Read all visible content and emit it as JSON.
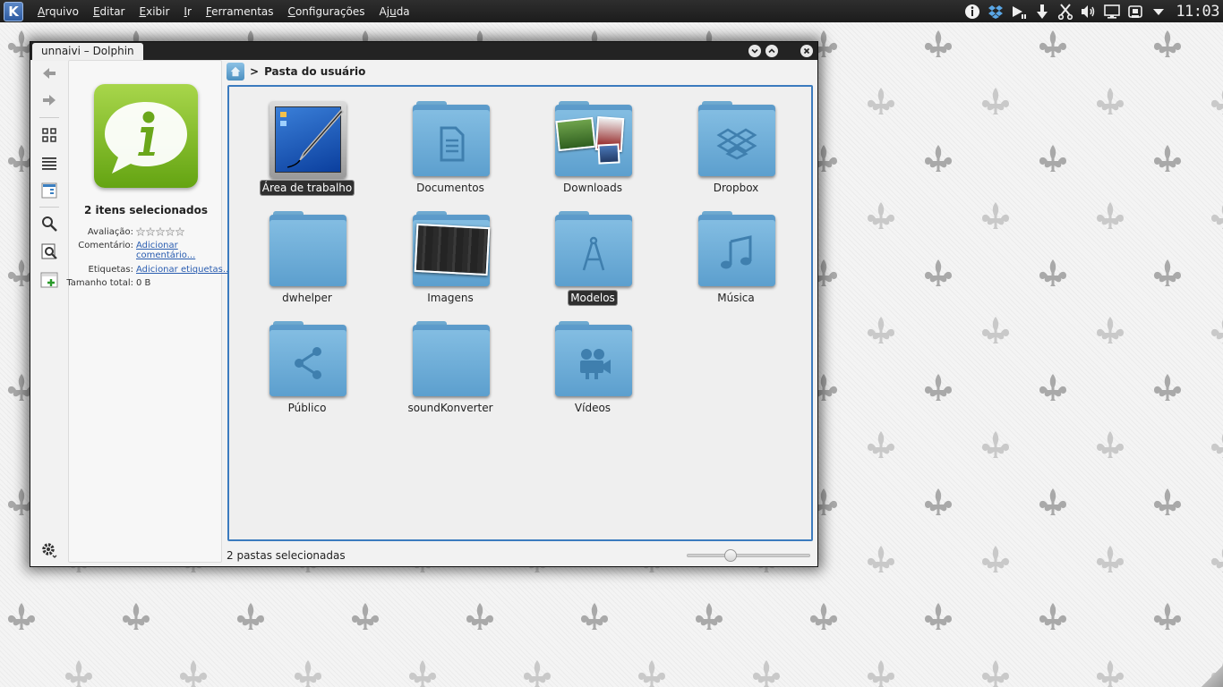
{
  "panel": {
    "kde_label": "K",
    "menus": [
      {
        "pre": "",
        "acc": "A",
        "post": "rquivo"
      },
      {
        "pre": "",
        "acc": "E",
        "post": "ditar"
      },
      {
        "pre": "",
        "acc": "E",
        "post": "xibir"
      },
      {
        "pre": "",
        "acc": "I",
        "post": "r"
      },
      {
        "pre": "",
        "acc": "F",
        "post": "erramentas"
      },
      {
        "pre": "",
        "acc": "C",
        "post": "onfigurações"
      },
      {
        "pre": "Aj",
        "acc": "u",
        "post": "da"
      }
    ],
    "tray_icons": [
      "info-icon",
      "dropbox-icon",
      "media-player-icon",
      "download-icon",
      "scissors-icon",
      "volume-icon",
      "display-icon",
      "network-icon",
      "expand-arrow-icon"
    ],
    "clock": "11:03"
  },
  "window": {
    "title": "unnaivi – Dolphin"
  },
  "info_panel": {
    "title": "2 itens selecionados",
    "rating_label": "Avaliação:",
    "rating_value": 0,
    "rating_max": 5,
    "comment_label": "Comentário:",
    "comment_link": "Adicionar comentário...",
    "tags_label": "Etiquetas:",
    "tags_link": "Adicionar etiquetas...",
    "size_label": "Tamanho total:",
    "size_value": "0 B",
    "accent": "#7ab82a"
  },
  "breadcrumb": {
    "separator": ">",
    "location": "Pasta do usuário"
  },
  "folders": [
    {
      "name": "Área de trabalho",
      "icon": "desktop-icon",
      "selected": true
    },
    {
      "name": "Documentos",
      "icon": "document-icon",
      "selected": false
    },
    {
      "name": "Downloads",
      "icon": "photos-icon",
      "selected": false
    },
    {
      "name": "Dropbox",
      "icon": "dropbox-icon",
      "selected": false
    },
    {
      "name": "dwhelper",
      "icon": "folder-icon",
      "selected": false
    },
    {
      "name": "Imagens",
      "icon": "image-icon",
      "selected": false
    },
    {
      "name": "Modelos",
      "icon": "compass-icon",
      "selected": true
    },
    {
      "name": "Música",
      "icon": "music-icon",
      "selected": false
    },
    {
      "name": "Público",
      "icon": "share-icon",
      "selected": false
    },
    {
      "name": "soundKonverter",
      "icon": "folder-icon",
      "selected": false
    },
    {
      "name": "Vídeos",
      "icon": "video-icon",
      "selected": false
    }
  ],
  "status": {
    "text": "2 pastas selecionadas",
    "zoom_fraction": 0.35
  },
  "colors": {
    "view_border": "#3b7bbf",
    "folder_light": "#83bde2",
    "folder_dark": "#3f80b3"
  }
}
